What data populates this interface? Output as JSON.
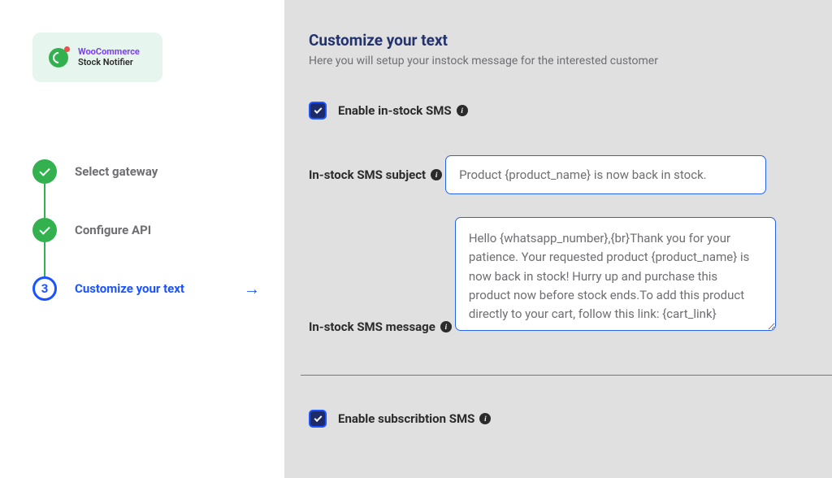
{
  "logo": {
    "brand": "WooCommerce",
    "sub": "Stock Notifier"
  },
  "steps": [
    {
      "label": "Select gateway",
      "state": "done"
    },
    {
      "label": "Configure API",
      "state": "done"
    },
    {
      "label": "Customize your text",
      "state": "current",
      "number": "3"
    }
  ],
  "page": {
    "title": "Customize your text",
    "subtitle": "Here you will setup your instock message for the interested customer"
  },
  "form": {
    "enable_instock_label": "Enable in-stock SMS",
    "enable_instock_checked": true,
    "subject_label": "In-stock SMS subject",
    "subject_value": "Product {product_name} is now back in stock.",
    "message_label": "In-stock SMS message",
    "message_value": "Hello {whatsapp_number},{br}Thank you for your patience. Your requested product {product_name} is now back in stock! Hurry up and purchase this product now before stock ends.To add this product directly to your cart, follow this link: {cart_link}",
    "enable_subscription_label": "Enable subscribtion SMS",
    "enable_subscription_checked": true
  }
}
